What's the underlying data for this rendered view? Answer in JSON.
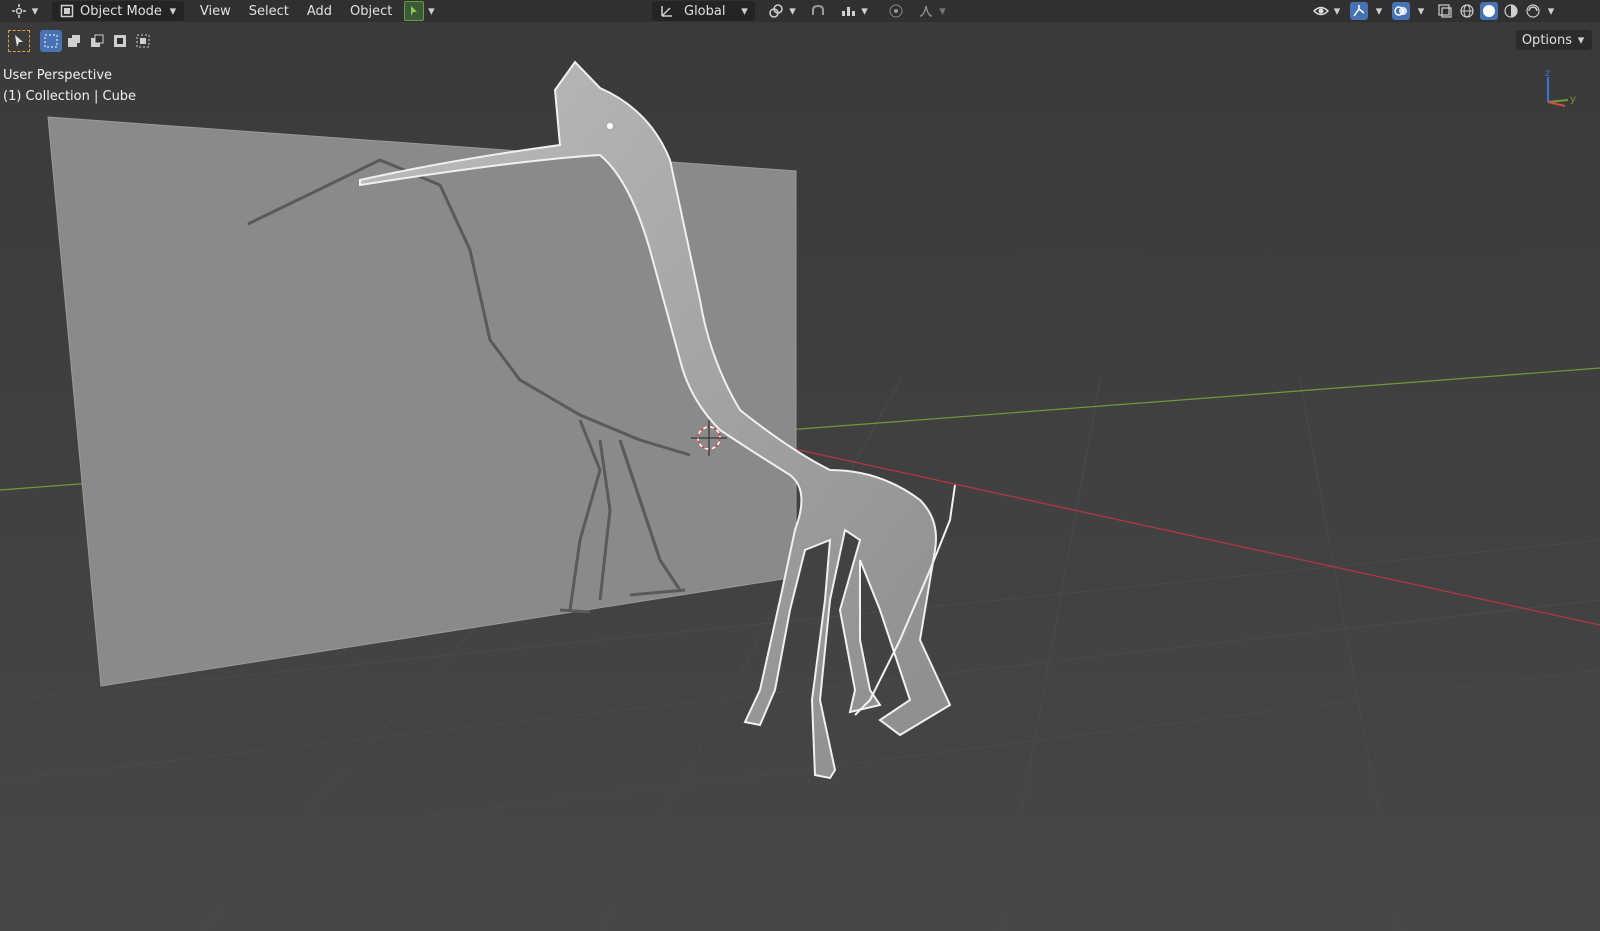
{
  "header": {
    "mode_label": "Object Mode",
    "menus": [
      "View",
      "Select",
      "Add",
      "Object"
    ],
    "transform_orientation": "Global",
    "icons": {
      "editor_type": "editor-type-icon",
      "mode": "object-mode-icon",
      "pivot": "pivot-icon",
      "orientation": "orientation-icon",
      "snap": "snap-icon",
      "snap_increment": "snap-increment-icon",
      "proportional": "proportional-edit-icon",
      "falloff": "falloff-icon",
      "visibility": "visibility-eye-icon",
      "gizmo": "gizmo-icon",
      "overlays": "overlays-icon",
      "xray": "xray-icon",
      "wireframe": "wireframe-shading-icon",
      "solid": "solid-shading-icon",
      "material": "material-shading-icon",
      "rendered": "rendered-shading-icon"
    }
  },
  "toolbar": {
    "options_label": "Options",
    "select_modes": [
      "select-new-icon",
      "select-extend-icon",
      "select-subtract-icon",
      "select-invert-icon",
      "select-intersect-icon"
    ]
  },
  "viewport": {
    "view_name": "User Perspective",
    "collection_info": "(1) Collection | Cube",
    "axis_labels": {
      "z": "z",
      "y": "y"
    }
  },
  "colors": {
    "header_bg": "#303030",
    "viewport_bg": "#3d3d3d",
    "accent_blue": "#4772b3",
    "x_axis": "#b5393d",
    "y_axis": "#6f9a3a",
    "plane": "#8a8a8a"
  }
}
